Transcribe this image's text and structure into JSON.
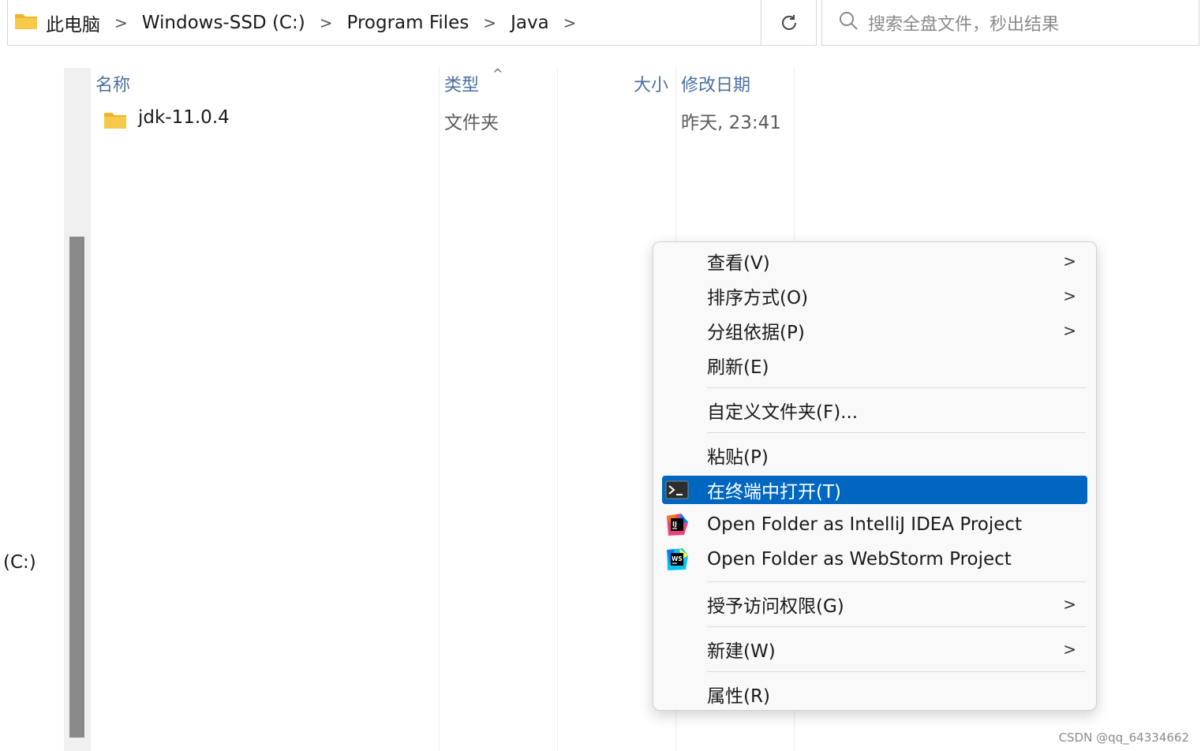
{
  "address_bar": {
    "breadcrumbs": [
      "此电脑",
      "Windows-SSD (C:)",
      "Program Files",
      "Java"
    ]
  },
  "search": {
    "placeholder": "搜索全盘文件，秒出结果"
  },
  "nav": {
    "drive_label": "(C:)"
  },
  "columns": {
    "name": "名称",
    "type": "类型",
    "size": "大小",
    "modified": "修改日期"
  },
  "files": [
    {
      "name": "jdk-11.0.4",
      "type": "文件夹",
      "size": "",
      "modified": "昨天, 23:41"
    }
  ],
  "context_menu": {
    "items": [
      {
        "label": "查看(V)",
        "submenu": true
      },
      {
        "label": "排序方式(O)",
        "submenu": true
      },
      {
        "label": "分组依据(P)",
        "submenu": true
      },
      {
        "label": "刷新(E)",
        "submenu": false
      },
      {
        "label": "自定义文件夹(F)...",
        "submenu": false
      },
      {
        "label": "粘贴(P)",
        "submenu": false
      },
      {
        "label": "在终端中打开(T)",
        "submenu": false,
        "icon": "terminal-icon",
        "highlighted": true
      },
      {
        "label": "Open Folder as IntelliJ IDEA Project",
        "submenu": false,
        "icon": "intellij-idea-icon"
      },
      {
        "label": "Open Folder as WebStorm Project",
        "submenu": false,
        "icon": "webstorm-icon"
      },
      {
        "label": "授予访问权限(G)",
        "submenu": true
      },
      {
        "label": "新建(W)",
        "submenu": true
      },
      {
        "label": "属性(R)",
        "submenu": false
      }
    ]
  },
  "colors": {
    "accent": "#0067c0",
    "folder": "#f7c948",
    "header_text": "#4b6fa3"
  },
  "watermark": "CSDN @qq_64334662"
}
